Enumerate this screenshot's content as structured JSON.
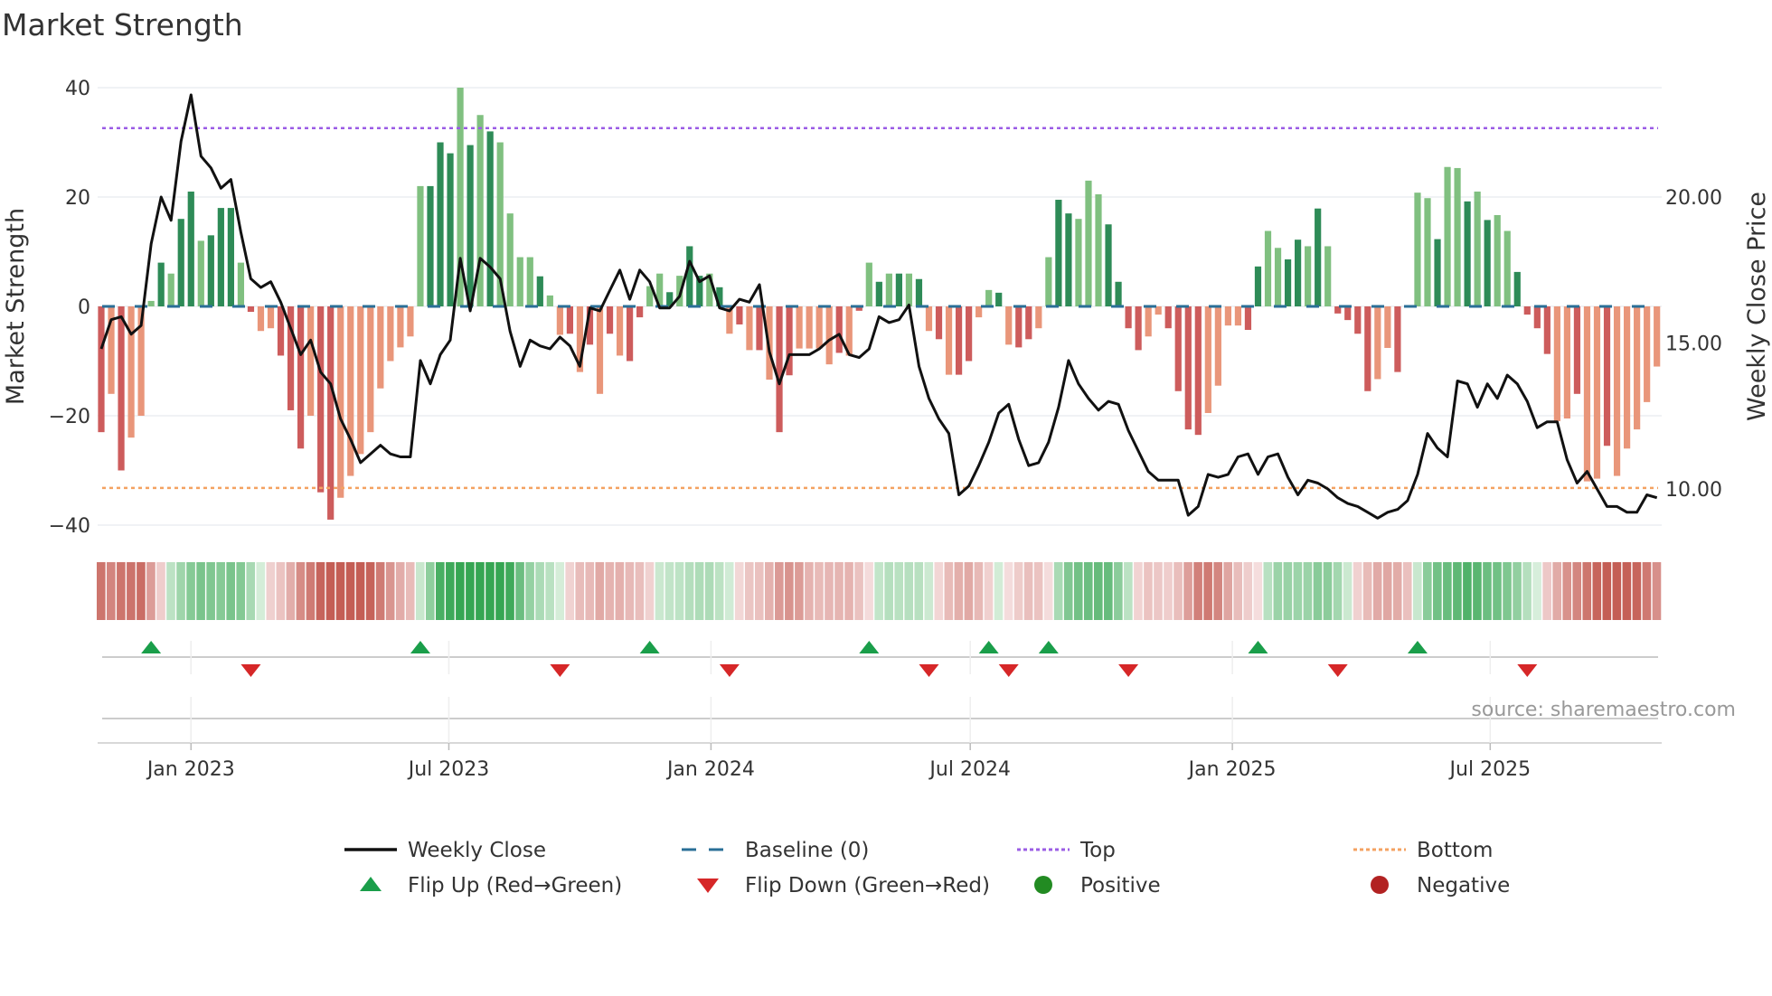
{
  "title": "Market Strength",
  "source": "source: sharemaestro.com",
  "colors": {
    "pos_dark": "#2e8b57",
    "pos_light": "#80c080",
    "neg_dark": "#cd5c5c",
    "neg_light": "#e9967a",
    "price": "#111111",
    "baseline": "#2a6f97",
    "top": "#9b5de5",
    "bottom": "#f4a261",
    "flip_up": "#1a9e4a",
    "flip_down": "#d62728",
    "positive": "#228b22",
    "negative": "#b22222"
  },
  "chart_data": {
    "type": "bar",
    "title": "Market Strength",
    "ylabel": "Market Strength",
    "y2label": "Weekly Close Price",
    "ylim": [
      -42,
      42
    ],
    "y2lim": [
      8.39,
      24.1
    ],
    "yticks": [
      40,
      20,
      0,
      -20,
      -40
    ],
    "yticklabels": [
      "40",
      "20",
      "0",
      "−20",
      "−40"
    ],
    "y2ticks": [
      20,
      15,
      10
    ],
    "y2ticklabels": [
      "20.00",
      "15.00",
      "10.00"
    ],
    "xticks": [
      "2023-01-01",
      "2023-07-01",
      "2024-01-01",
      "2024-07-01",
      "2025-01-01",
      "2025-07-01"
    ],
    "xticklabels": [
      "Jan 2023",
      "Jul 2023",
      "Jan 2024",
      "Jul 2024",
      "Jan 2025",
      "Jul 2025"
    ],
    "x_start": "2022-10-30",
    "x_frequency": "weekly",
    "grid": true,
    "top_level": 32.6,
    "bottom_level": -33.2,
    "baseline": 0,
    "strength": [
      -23,
      -16,
      -30,
      -24,
      -20,
      1,
      8,
      6,
      16,
      21,
      12,
      13,
      18,
      18,
      8,
      -1,
      -4.5,
      -4,
      -9,
      -19,
      -26,
      -20,
      -34,
      -39,
      -35,
      -31,
      -27,
      -23,
      -15,
      -10,
      -7.5,
      -5.5,
      22,
      22,
      30,
      28,
      40,
      29.5,
      35,
      32,
      30,
      17,
      9,
      9,
      5.5,
      2,
      -5.2,
      -5,
      -12,
      -7,
      -16,
      -5,
      -9,
      -10,
      -2,
      3.7,
      6,
      2.6,
      5.6,
      11,
      5.6,
      6,
      3.5,
      -5,
      -3.3,
      -8,
      -8,
      -13.4,
      -23,
      -12.6,
      -7.7,
      -7.7,
      -7.7,
      -10.6,
      -8.5,
      -9,
      -0.8,
      8,
      4.5,
      6,
      6,
      6,
      5,
      -4.5,
      -6,
      -12.5,
      -12.5,
      -10,
      -2,
      3,
      2.5,
      -7,
      -7.5,
      -6,
      -4,
      9,
      19.5,
      17,
      16,
      23,
      20.5,
      15,
      4.5,
      -4,
      -8,
      -5.5,
      -1.5,
      -4,
      -15.5,
      -22.5,
      -23.5,
      -19.5,
      -14.5,
      -3.5,
      -3.5,
      -4.3,
      7.3,
      13.8,
      10.7,
      8.6,
      12.2,
      11,
      17.9,
      11,
      -1.3,
      -2.5,
      -5,
      -15.5,
      -13.3,
      -7.6,
      -12,
      0,
      20.8,
      19.8,
      12.3,
      25.5,
      25.3,
      19.2,
      21,
      15.8,
      16.7,
      13.8,
      6.3,
      -1.5,
      -4,
      -8.7,
      -21,
      -20.5,
      -16,
      -32,
      -31.5,
      -25.5,
      -31,
      -26,
      -22.5,
      -17.5,
      -11
    ],
    "shades": "dldllldlddldddldlldddlddllllllllldddldldlllldlldldldlddlldlddldldldlddlllldldldldldldlddlldlddllddlllddddllddddllllddllddldlddddllddlldlldldllddddlldlldllll",
    "weekly_close": [
      14.8,
      15.8,
      15.9,
      15.3,
      15.6,
      18.4,
      20.0,
      19.2,
      21.9,
      23.5,
      21.4,
      21.0,
      20.3,
      20.6,
      18.8,
      17.2,
      16.9,
      17.1,
      16.4,
      15.5,
      14.6,
      15.1,
      14.0,
      13.6,
      12.4,
      11.7,
      10.9,
      11.2,
      11.5,
      11.2,
      11.1,
      11.1,
      14.4,
      13.6,
      14.6,
      15.1,
      17.9,
      16.1,
      17.9,
      17.6,
      17.2,
      15.4,
      14.2,
      15.1,
      14.9,
      14.8,
      15.2,
      14.9,
      14.2,
      16.2,
      16.1,
      16.8,
      17.5,
      16.5,
      17.5,
      17.1,
      16.2,
      16.2,
      16.6,
      17.8,
      17.1,
      17.3,
      16.2,
      16.1,
      16.5,
      16.4,
      17.0,
      14.7,
      13.6,
      14.6,
      14.6,
      14.6,
      14.8,
      15.1,
      15.3,
      14.6,
      14.5,
      14.8,
      15.9,
      15.7,
      15.8,
      16.3,
      14.2,
      13.1,
      12.4,
      11.9,
      9.8,
      10.1,
      10.8,
      11.6,
      12.6,
      12.9,
      11.7,
      10.8,
      10.9,
      11.6,
      12.8,
      14.4,
      13.6,
      13.1,
      12.7,
      13.0,
      12.9,
      12.0,
      11.3,
      10.6,
      10.3,
      10.3,
      10.3,
      9.1,
      9.4,
      10.5,
      10.4,
      10.5,
      11.1,
      11.2,
      10.5,
      11.1,
      11.2,
      10.4,
      9.8,
      10.3,
      10.2,
      10.0,
      9.7,
      9.5,
      9.4,
      9.2,
      9.0,
      9.2,
      9.3,
      9.6,
      10.5,
      11.9,
      11.4,
      11.1,
      13.7,
      13.6,
      12.8,
      13.6,
      13.1,
      13.9,
      13.6,
      13.0,
      12.1,
      12.3,
      12.3,
      11.0,
      10.2,
      10.6,
      10.0,
      9.4,
      9.4,
      9.2,
      9.2,
      9.8,
      9.7
    ],
    "flip_up": [
      "2022-12-04",
      "2023-06-11",
      "2023-11-19",
      "2024-04-21",
      "2024-07-14",
      "2024-08-25",
      "2025-01-19",
      "2025-05-11"
    ],
    "flip_down": [
      "2023-02-12",
      "2023-09-17",
      "2024-01-14",
      "2024-06-02",
      "2024-07-28",
      "2024-10-20",
      "2025-03-16",
      "2025-07-27"
    ],
    "legend_position": "bottom",
    "legend": [
      {
        "key": "close",
        "label": "Weekly Close"
      },
      {
        "key": "baseline",
        "label": "Baseline (0)"
      },
      {
        "key": "top",
        "label": "Top"
      },
      {
        "key": "bottom",
        "label": "Bottom"
      },
      {
        "key": "flip_up",
        "label": "Flip Up (Red→Green)"
      },
      {
        "key": "flip_down",
        "label": "Flip Down (Green→Red)"
      },
      {
        "key": "positive",
        "label": "Positive"
      },
      {
        "key": "negative",
        "label": "Negative"
      }
    ]
  }
}
